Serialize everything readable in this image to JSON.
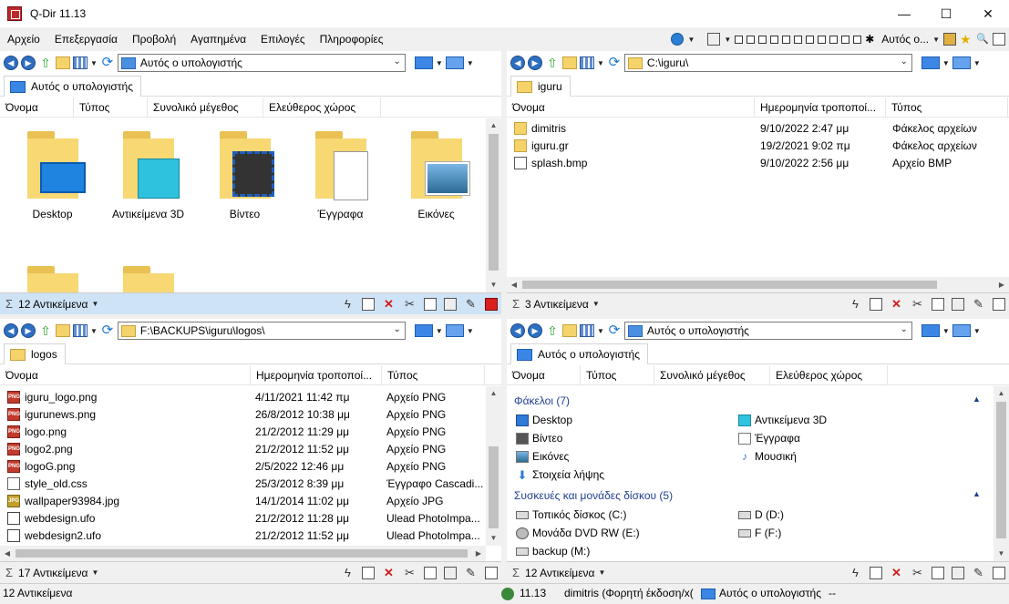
{
  "window": {
    "title": "Q-Dir 11.13",
    "controls": {
      "minimize": "—",
      "maximize": "☐",
      "close": "✕"
    }
  },
  "menu": [
    "Αρχείο",
    "Επεξεργασία",
    "Προβολή",
    "Αγαπημένα",
    "Επιλογές",
    "Πληροφορίες"
  ],
  "toolbar_right": {
    "label": "Αυτός ο..."
  },
  "panes": {
    "top_left": {
      "address": "Αυτός ο υπολογιστής",
      "tab": "Αυτός ο υπολογιστής",
      "columns": [
        "Όνομα",
        "Τύπος",
        "Συνολικό μέγεθος",
        "Ελεύθερος χώρος"
      ],
      "items": [
        "Desktop",
        "Αντικείμενα 3D",
        "Βίντεο",
        "Έγγραφα",
        "Εικόνες"
      ],
      "status": "12 Αντικείμενα"
    },
    "top_right": {
      "address": "C:\\iguru\\",
      "tab": "iguru",
      "columns": [
        "Όνομα",
        "Ημερομηνία τροποποί...",
        "Τύπος"
      ],
      "rows": [
        {
          "name": "dimitris",
          "date": "9/10/2022 2:47 μμ",
          "type": "Φάκελος αρχείων",
          "icon": "folder"
        },
        {
          "name": "iguru.gr",
          "date": "19/2/2021 9:02 πμ",
          "type": "Φάκελος αρχείων",
          "icon": "folder"
        },
        {
          "name": "splash.bmp",
          "date": "9/10/2022 2:56 μμ",
          "type": "Αρχείο BMP",
          "icon": "bmp"
        }
      ],
      "status": "3 Αντικείμενα"
    },
    "bottom_left": {
      "address": "F:\\BACKUPS\\iguru\\logos\\",
      "tab": "logos",
      "columns": [
        "Όνομα",
        "Ημερομηνία τροποποί...",
        "Τύπος"
      ],
      "rows": [
        {
          "name": "iguru_logo.png",
          "date": "4/11/2021 11:42 πμ",
          "type": "Αρχείο PNG",
          "icon": "png"
        },
        {
          "name": "igurunews.png",
          "date": "26/8/2012 10:38 μμ",
          "type": "Αρχείο PNG",
          "icon": "png"
        },
        {
          "name": "logo.png",
          "date": "21/2/2012 11:29 μμ",
          "type": "Αρχείο PNG",
          "icon": "png"
        },
        {
          "name": "logo2.png",
          "date": "21/2/2012 11:52 μμ",
          "type": "Αρχείο PNG",
          "icon": "png"
        },
        {
          "name": "logoG.png",
          "date": "2/5/2022 12:46 μμ",
          "type": "Αρχείο PNG",
          "icon": "png"
        },
        {
          "name": "style_old.css",
          "date": "25/3/2012 8:39 μμ",
          "type": "Έγγραφο Cascadi...",
          "icon": "css"
        },
        {
          "name": "wallpaper93984.jpg",
          "date": "14/1/2014 11:02 μμ",
          "type": "Αρχείο JPG",
          "icon": "jpg"
        },
        {
          "name": "webdesign.ufo",
          "date": "21/2/2012 11:28 μμ",
          "type": "Ulead PhotoImpa...",
          "icon": "ufo"
        },
        {
          "name": "webdesign2.ufo",
          "date": "21/2/2012 11:52 μμ",
          "type": "Ulead PhotoImpa...",
          "icon": "ufo"
        }
      ],
      "status": "17 Αντικείμενα"
    },
    "bottom_right": {
      "address": "Αυτός ο υπολογιστής",
      "tab": "Αυτός ο υπολογιστής",
      "columns": [
        "Όνομα",
        "Τύπος",
        "Συνολικό μέγεθος",
        "Ελεύθερος χώρος"
      ],
      "group_folders": "Φάκελοι (7)",
      "folders": [
        "Desktop",
        "Αντικείμενα 3D",
        "Βίντεο",
        "Έγγραφα",
        "Εικόνες",
        "Μουσική",
        "Στοιχεία λήψης"
      ],
      "group_drives": "Συσκευές και μονάδες δίσκου (5)",
      "drives": [
        "Τοπικός δίσκος (C:)",
        "D (D:)",
        "Μονάδα DVD RW (E:)",
        "F (F:)",
        "backup (M:)"
      ],
      "status": "12 Αντικείμενα"
    }
  },
  "bottombar": {
    "count": "12 Αντικείμενα",
    "version": "11.13",
    "user": "dimitris (Φορητή έκδοση/x(",
    "location": "Αυτός ο υπολογιστής",
    "extra": "--"
  }
}
